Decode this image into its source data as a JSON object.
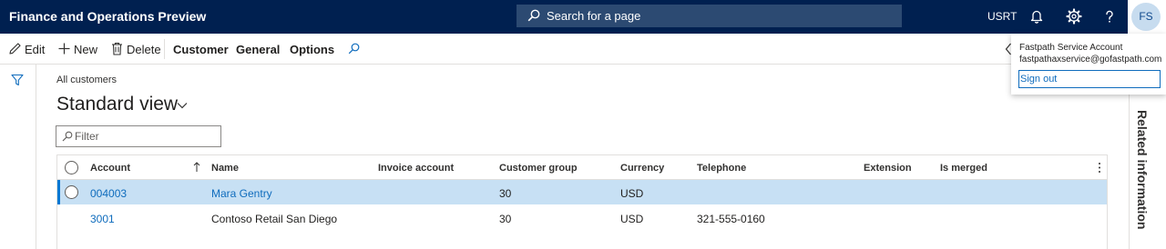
{
  "header": {
    "app_title": "Finance and Operations Preview",
    "search_placeholder": "Search for a page",
    "company": "USRT",
    "avatar_initials": "FS",
    "icons": [
      "search-icon",
      "bell-icon",
      "gear-icon",
      "help-icon"
    ]
  },
  "actions": {
    "edit": "Edit",
    "new": "New",
    "delete": "Delete",
    "menus": [
      "Customer",
      "General",
      "Options"
    ]
  },
  "page": {
    "breadcrumb": "All customers",
    "view_title": "Standard view",
    "filter_placeholder": "Filter"
  },
  "grid": {
    "columns": [
      "Account",
      "Name",
      "Invoice account",
      "Customer group",
      "Currency",
      "Telephone",
      "Extension",
      "Is merged"
    ],
    "rows": [
      {
        "account": "004003",
        "name": "Mara Gentry",
        "invoice_account": "",
        "customer_group": "30",
        "currency": "USD",
        "telephone": "",
        "extension": "",
        "is_merged": "",
        "selected": true
      },
      {
        "account": "3001",
        "name": "Contoso Retail San Diego",
        "invoice_account": "",
        "customer_group": "30",
        "currency": "USD",
        "telephone": "321-555-0160",
        "extension": "",
        "is_merged": "",
        "selected": false
      }
    ]
  },
  "related_panel": {
    "label": "Related information"
  },
  "account_popup": {
    "name": "Fastpath Service Account",
    "email": "fastpathaxservice@gofastpath.com",
    "sign_out": "Sign out"
  },
  "colors": {
    "nav_bg": "#002050",
    "accent": "#0078d4",
    "link": "#0f6cbd",
    "selected_row": "#c7e0f4"
  }
}
